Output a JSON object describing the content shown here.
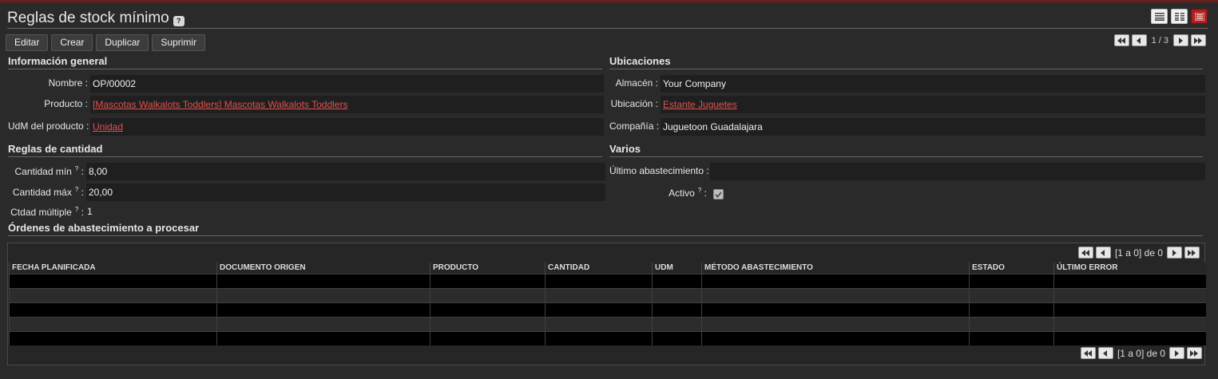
{
  "page": {
    "title": "Reglas de stock mínimo",
    "help": "?"
  },
  "toolbar": {
    "edit": "Editar",
    "create": "Crear",
    "duplicate": "Duplicar",
    "delete": "Suprimir"
  },
  "pager": {
    "text": "1 / 3"
  },
  "general": {
    "title": "Información general",
    "name_label": "Nombre :",
    "name_value": "OP/00002",
    "product_label": "Producto :",
    "product_value": "[Mascotas Walkalots Toddlers] Mascotas Walkalots Toddlers",
    "uom_label": "UdM del producto :",
    "uom_value": "Unidad"
  },
  "locations": {
    "title": "Ubicaciones",
    "warehouse_label": "Almacén :",
    "warehouse_value": "Your Company",
    "location_label": "Ubicación :",
    "location_value": "Estante Juguetes",
    "company_label": "Compañía :",
    "company_value": "Juguetoon Guadalajara"
  },
  "quantity": {
    "title": "Reglas de cantidad",
    "min_label": "Cantidad mín",
    "min_value": "8,00",
    "max_label": "Cantidad máx",
    "max_value": "20,00",
    "multiple_label": "Ctdad múltiple",
    "multiple_value": "1",
    "help": "?",
    "colon": ":"
  },
  "misc": {
    "title": "Varios",
    "last_label": "Último abastecimiento :",
    "last_value": "",
    "active_label": "Activo",
    "active_checked": true,
    "help": "?",
    "colon": ":"
  },
  "orders": {
    "title": "Órdenes de abastecimiento a procesar",
    "pager_text": "[1 a 0] de 0",
    "columns": [
      "FECHA PLANIFICADA",
      "DOCUMENTO ORIGEN",
      "PRODUCTO",
      "CANTIDAD",
      "UDM",
      "MÉTODO ABASTECIMIENTO",
      "ESTADO",
      "ÚLTIMO ERROR"
    ],
    "rows": []
  },
  "colors": {
    "accent": "#b31c1c",
    "link": "#e25050",
    "background": "#2a2a2a",
    "field": "#1f1f1f"
  }
}
